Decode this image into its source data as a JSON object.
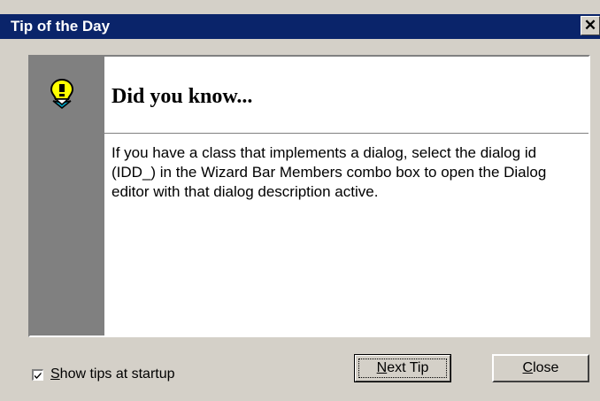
{
  "window": {
    "title": "Tip of the Day",
    "close_glyph": "✕",
    "title_bar_color": "#0a246a",
    "face_color": "#d4d0c8"
  },
  "tip": {
    "icon": "lightbulb-icon",
    "heading": "Did you know...",
    "body": "If you have a class that implements a dialog, select the dialog id (IDD_) in the Wizard Bar Members combo box to open the Dialog editor with that dialog description active."
  },
  "startup_option": {
    "label_underlined": "S",
    "label_rest": "how tips at startup",
    "checked": true
  },
  "buttons": {
    "next_underlined": "N",
    "next_rest": "ext Tip",
    "close_underlined": "C",
    "close_rest": "lose"
  }
}
